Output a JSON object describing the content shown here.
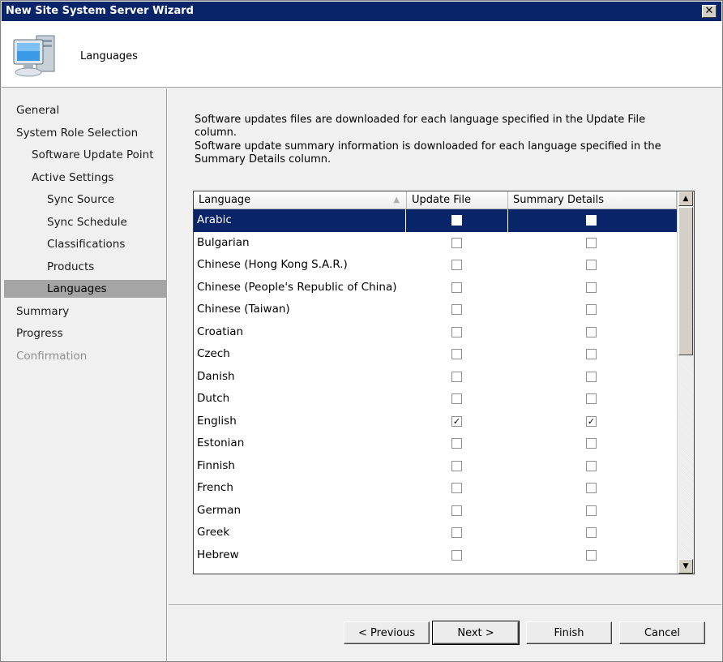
{
  "window": {
    "title": "New Site System Server Wizard",
    "close_label": "✕"
  },
  "header": {
    "title": "Languages",
    "icon": "computer-icon"
  },
  "nav": {
    "items": [
      {
        "label": "General",
        "indent": 0,
        "state": "normal"
      },
      {
        "label": "System Role Selection",
        "indent": 0,
        "state": "normal"
      },
      {
        "label": "Software Update Point",
        "indent": 1,
        "state": "normal"
      },
      {
        "label": "Active Settings",
        "indent": 1,
        "state": "normal"
      },
      {
        "label": "Sync Source",
        "indent": 2,
        "state": "normal"
      },
      {
        "label": "Sync Schedule",
        "indent": 2,
        "state": "normal"
      },
      {
        "label": "Classifications",
        "indent": 2,
        "state": "normal"
      },
      {
        "label": "Products",
        "indent": 2,
        "state": "normal"
      },
      {
        "label": "Languages",
        "indent": 2,
        "state": "selected"
      },
      {
        "label": "Summary",
        "indent": 0,
        "state": "normal"
      },
      {
        "label": "Progress",
        "indent": 0,
        "state": "normal"
      },
      {
        "label": "Confirmation",
        "indent": 0,
        "state": "disabled"
      }
    ]
  },
  "content": {
    "info_update_file": "Software updates files are downloaded for each language specified in the Update File column.",
    "info_summary": "Software update summary information is downloaded for each language specified in the Summary Details column."
  },
  "grid": {
    "columns": [
      "Language",
      "Update File",
      "Summary Details"
    ],
    "sort_indicator": "▲",
    "rows": [
      {
        "language": "Arabic",
        "update_file": false,
        "summary_details": false,
        "selected": true
      },
      {
        "language": "Bulgarian",
        "update_file": false,
        "summary_details": false
      },
      {
        "language": "Chinese (Hong Kong S.A.R.)",
        "update_file": false,
        "summary_details": false
      },
      {
        "language": "Chinese (People's Republic of China)",
        "update_file": false,
        "summary_details": false
      },
      {
        "language": "Chinese (Taiwan)",
        "update_file": false,
        "summary_details": false
      },
      {
        "language": "Croatian",
        "update_file": false,
        "summary_details": false
      },
      {
        "language": "Czech",
        "update_file": false,
        "summary_details": false
      },
      {
        "language": "Danish",
        "update_file": false,
        "summary_details": false
      },
      {
        "language": "Dutch",
        "update_file": false,
        "summary_details": false
      },
      {
        "language": "English",
        "update_file": true,
        "summary_details": true
      },
      {
        "language": "Estonian",
        "update_file": false,
        "summary_details": false
      },
      {
        "language": "Finnish",
        "update_file": false,
        "summary_details": false
      },
      {
        "language": "French",
        "update_file": false,
        "summary_details": false
      },
      {
        "language": "German",
        "update_file": false,
        "summary_details": false
      },
      {
        "language": "Greek",
        "update_file": false,
        "summary_details": false
      },
      {
        "language": "Hebrew",
        "update_file": false,
        "summary_details": false
      }
    ],
    "scroll_up": "▲",
    "scroll_down": "▼"
  },
  "buttons": {
    "previous": "< Previous",
    "next": "Next >",
    "finish": "Finish",
    "cancel": "Cancel"
  },
  "colors": {
    "titlebar": "#0a246a",
    "selection": "#0a246a",
    "nav_selected": "#a5a5a5"
  }
}
